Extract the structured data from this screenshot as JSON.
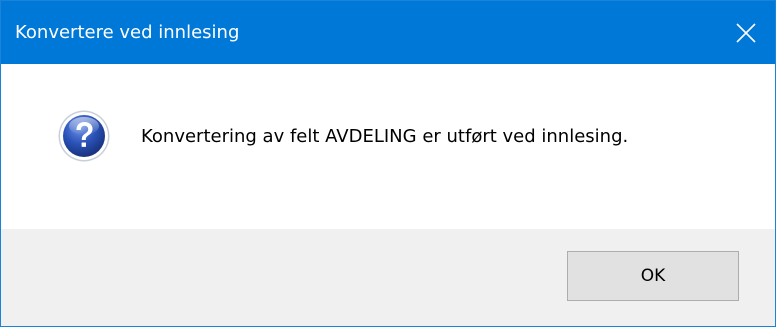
{
  "window": {
    "title": "Konvertere ved innlesing",
    "close_icon": "close-icon"
  },
  "content": {
    "icon": "question-icon",
    "message": "Konvertering av felt AVDELING er utført ved innlesing."
  },
  "buttons": {
    "ok_label": "OK"
  },
  "colors": {
    "titlebar": "#0078d7",
    "footer": "#f0f0f0"
  }
}
